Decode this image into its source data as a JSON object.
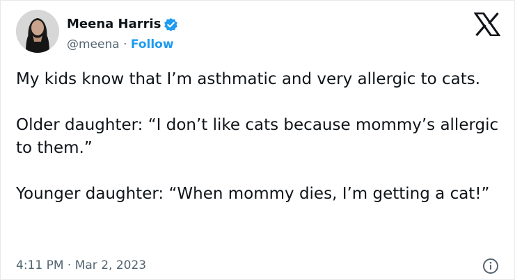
{
  "author": {
    "name": "Meena Harris",
    "handle": "@meena",
    "separator": "·",
    "follow_label": "Follow",
    "verified_color": "#1d9bf0"
  },
  "tweet": {
    "paragraphs": [
      "My kids know that I’m asthmatic and very allergic to cats.",
      "Older daughter: “I don’t like cats because mommy’s allergic to them.”",
      "Younger daughter: “When mommy dies, I’m getting a cat!”"
    ],
    "time": "4:11 PM",
    "date_separator": "·",
    "date": "Mar 2, 2023"
  },
  "icons": {
    "platform": "x-logo-icon",
    "badge": "verified-badge-icon",
    "info": "info-icon"
  }
}
